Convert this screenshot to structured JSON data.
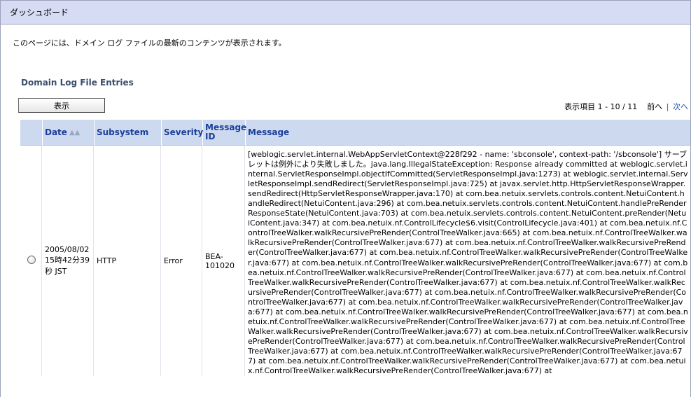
{
  "header": {
    "title": "ダッシュボード"
  },
  "intro_text": "このページには、ドメイン ログ ファイルの最新のコンテンツが表示されます。",
  "section": {
    "title": "Domain Log File Entries"
  },
  "toolbar": {
    "show_label": "表示"
  },
  "pager": {
    "summary": "表示項目 1 - 10 / 11",
    "prev_label": "前へ",
    "separator": "|",
    "next_label": "次へ"
  },
  "table": {
    "columns": {
      "date": "Date",
      "subsystem": "Subsystem",
      "severity": "Severity",
      "message_id": "Message ID",
      "message": "Message"
    },
    "sort_icon": "sort-ascending-icon",
    "rows": [
      {
        "date": "2005/08/02 15時42分39秒 JST",
        "subsystem": "HTTP",
        "severity": "Error",
        "message_id": "BEA-101020",
        "message": "[weblogic.servlet.internal.WebAppServletContext@228f292 - name: 'sbconsole', context-path: '/sbconsole'] サーブレットは例外により失敗しました。java.lang.IllegalStateException: Response already committed at weblogic.servlet.internal.ServletResponseImpl.objectIfCommitted(ServletResponseImpl.java:1273) at weblogic.servlet.internal.ServletResponseImpl.sendRedirect(ServletResponseImpl.java:725) at javax.servlet.http.HttpServletResponseWrapper.sendRedirect(HttpServletResponseWrapper.java:170) at com.bea.netuix.servlets.controls.content.NetuiContent.handleRedirect(NetuiContent.java:296) at com.bea.netuix.servlets.controls.content.NetuiContent.handlePreRenderResponseState(NetuiContent.java:703) at com.bea.netuix.servlets.controls.content.NetuiContent.preRender(NetuiContent.java:347) at com.bea.netuix.nf.ControlLifecycle$6.visit(ControlLifecycle.java:401) at com.bea.netuix.nf.ControlTreeWalker.walkRecursivePreRender(ControlTreeWalker.java:665) at com.bea.netuix.nf.ControlTreeWalker.walkRecursivePreRender(ControlTreeWalker.java:677) at com.bea.netuix.nf.ControlTreeWalker.walkRecursivePreRender(ControlTreeWalker.java:677) at com.bea.netuix.nf.ControlTreeWalker.walkRecursivePreRender(ControlTreeWalker.java:677) at com.bea.netuix.nf.ControlTreeWalker.walkRecursivePreRender(ControlTreeWalker.java:677) at com.bea.netuix.nf.ControlTreeWalker.walkRecursivePreRender(ControlTreeWalker.java:677) at com.bea.netuix.nf.ControlTreeWalker.walkRecursivePreRender(ControlTreeWalker.java:677) at com.bea.netuix.nf.ControlTreeWalker.walkRecursivePreRender(ControlTreeWalker.java:677) at com.bea.netuix.nf.ControlTreeWalker.walkRecursivePreRender(ControlTreeWalker.java:677) at com.bea.netuix.nf.ControlTreeWalker.walkRecursivePreRender(ControlTreeWalker.java:677) at com.bea.netuix.nf.ControlTreeWalker.walkRecursivePreRender(ControlTreeWalker.java:677) at com.bea.netuix.nf.ControlTreeWalker.walkRecursivePreRender(ControlTreeWalker.java:677) at com.bea.netuix.nf.ControlTreeWalker.walkRecursivePreRender(ControlTreeWalker.java:677) at com.bea.netuix.nf.ControlTreeWalker.walkRecursivePreRender(ControlTreeWalker.java:677) at com.bea.netuix.nf.ControlTreeWalker.walkRecursivePreRender(ControlTreeWalker.java:677) at com.bea.netuix.nf.ControlTreeWalker.walkRecursivePreRender(ControlTreeWalker.java:677) at com.bea.netuix.nf.ControlTreeWalker.walkRecursivePreRender(ControlTreeWalker.java:677) at com.bea.netuix.nf.ControlTreeWalker.walkRecursivePreRender(ControlTreeWalker.java:677) at"
      }
    ]
  },
  "colors": {
    "title_bar_bg": "#d7dcf5",
    "header_bg": "#cdd9ef",
    "header_text": "#1b3f9a",
    "section_title": "#3a4e6b",
    "link": "#2050b0"
  }
}
